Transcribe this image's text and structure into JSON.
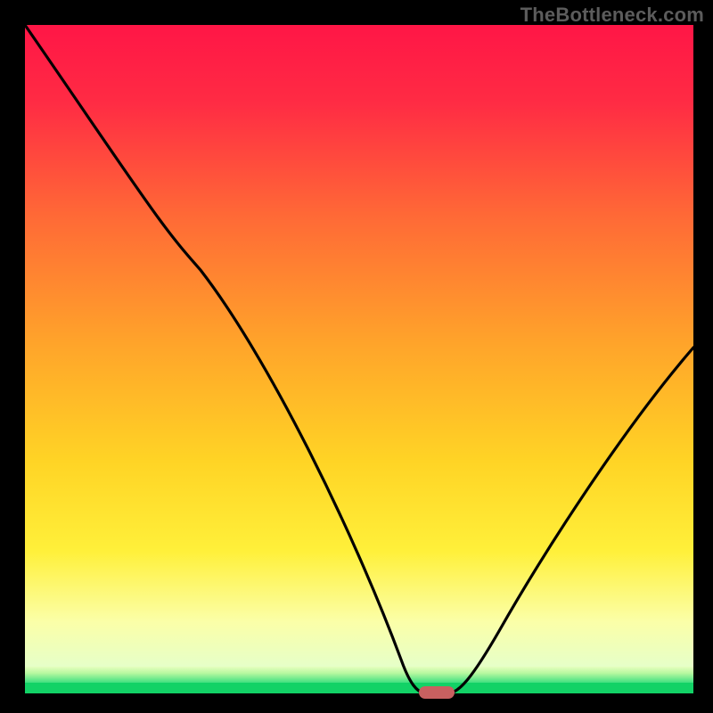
{
  "watermark": "TheBottleneck.com",
  "chart_data": {
    "type": "line",
    "title": "",
    "xlabel": "",
    "ylabel": "",
    "xlim": [
      0,
      100
    ],
    "ylim": [
      0,
      100
    ],
    "legend": false,
    "grid": false,
    "background": "red-yellow-green vertical gradient (bottleneck heatmap)",
    "x": [
      0,
      5,
      12,
      20,
      28,
      36,
      44,
      52,
      57,
      59,
      61,
      63,
      65,
      70,
      78,
      86,
      94,
      100
    ],
    "y": [
      100,
      94,
      84,
      72,
      60,
      47,
      33,
      14,
      3,
      0,
      0,
      1,
      4,
      12,
      26,
      40,
      52,
      60
    ],
    "curve_description": "Sharp V-shaped curve; starts at top-left, descends (with a slight knee around 20-25% x) to a minimum near x≈60%, then rises toward the right edge to about 60% height.",
    "marker": {
      "x": 60,
      "y": 0,
      "shape": "rounded-rect",
      "color": "#c86060"
    },
    "bottom_band": {
      "color": "#12d266",
      "y_start": 0,
      "y_end": 2
    }
  }
}
